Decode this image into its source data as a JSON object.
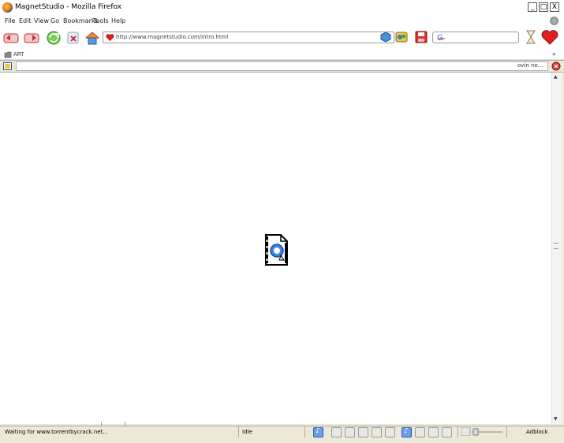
{
  "window": {
    "title": "MagnetStudio - Mozilla Firefox",
    "min": "_",
    "max": "□",
    "close": "X"
  },
  "menu": {
    "items": [
      "File",
      "Edit",
      "View",
      "Go",
      "Bookmarks",
      "Tools",
      "Help"
    ]
  },
  "navbar": {
    "url": "http://www.magnetstudio.com/intro.html",
    "search_placeholder": ""
  },
  "bookmarks": {
    "label": "ART",
    "overflow": "»"
  },
  "tabbar": {
    "tab_label": "ovin ne..."
  },
  "status": {
    "message": "Waiting for www.torrentbycrack.net...",
    "state": "Idle",
    "adblock": "Adblock"
  },
  "colors": {
    "accent_red": "#d42020",
    "accent_blue": "#2a6ad0",
    "accent_green": "#2aa02a"
  }
}
